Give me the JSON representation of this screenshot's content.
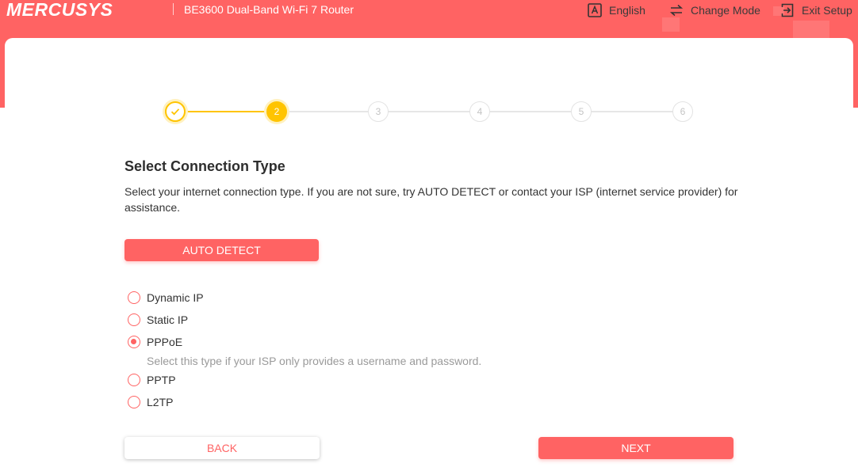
{
  "header": {
    "logo": "MERCUSYS",
    "product": "BE3600 Dual-Band Wi-Fi 7 Router",
    "language": "English",
    "change_mode": "Change Mode",
    "exit_setup": "Exit Setup"
  },
  "steps": [
    {
      "label": "",
      "state": "done"
    },
    {
      "label": "2",
      "state": "active"
    },
    {
      "label": "3",
      "state": "todo"
    },
    {
      "label": "4",
      "state": "todo"
    },
    {
      "label": "5",
      "state": "todo"
    },
    {
      "label": "6",
      "state": "todo"
    }
  ],
  "main": {
    "title": "Select Connection Type",
    "description": "Select your internet connection type. If you are not sure, try AUTO DETECT or contact your ISP (internet service provider) for assistance.",
    "auto_detect": "AUTO DETECT",
    "options": [
      {
        "label": "Dynamic IP",
        "checked": false
      },
      {
        "label": "Static IP",
        "checked": false
      },
      {
        "label": "PPPoE",
        "checked": true
      },
      {
        "label": "PPTP",
        "checked": false
      },
      {
        "label": "L2TP",
        "checked": false
      }
    ],
    "pppoe_hint": "Select this type if your ISP only provides a username and password.",
    "back": "BACK",
    "next": "NEXT"
  },
  "colors": {
    "brand": "#ff6363",
    "step_active": "#ffc400",
    "step_todo": "#e3e3e3"
  },
  "icons": {
    "language": "language-icon",
    "change_mode": "change-mode-icon",
    "exit": "exit-icon",
    "check": "check-icon"
  }
}
